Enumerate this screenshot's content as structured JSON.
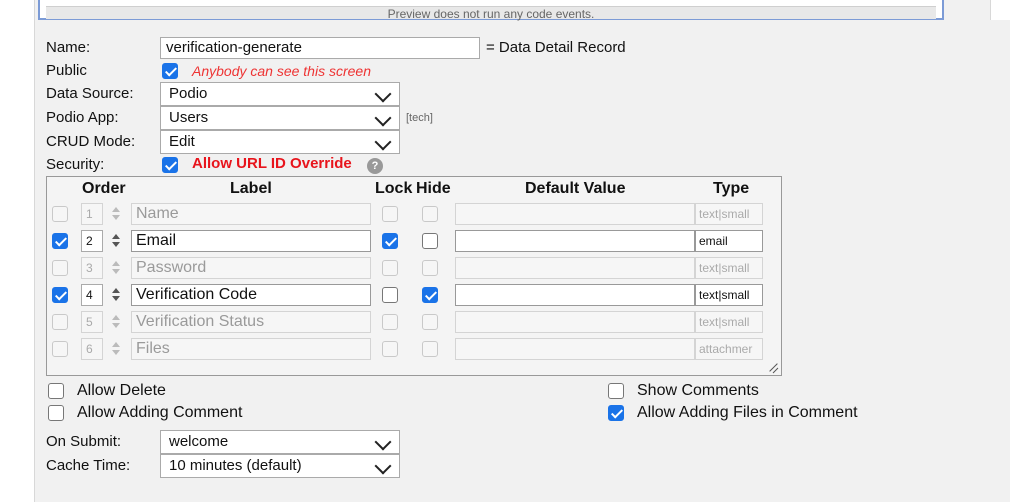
{
  "preview": {
    "note": "Preview does not run any code events."
  },
  "form": {
    "name": {
      "label": "Name:",
      "value": "verification-generate",
      "suffix": "= Data Detail Record"
    },
    "public": {
      "label": "Public",
      "checked": true,
      "hint": "Anybody can see this screen"
    },
    "data_source": {
      "label": "Data Source:",
      "value": "Podio"
    },
    "podio_app": {
      "label": "Podio App:",
      "value": "Users",
      "tag": "[tech]"
    },
    "crud_mode": {
      "label": "CRUD Mode:",
      "value": "Edit"
    },
    "security": {
      "label": "Security:",
      "checked": true,
      "option": "Allow URL ID Override",
      "help": "?"
    }
  },
  "fields_table": {
    "headers": {
      "order": "Order",
      "label": "Label",
      "lock": "Lock",
      "hide": "Hide",
      "default": "Default Value",
      "type": "Type"
    },
    "rows": [
      {
        "enabled": false,
        "order": "1",
        "label": "Name",
        "lock": false,
        "hide": false,
        "default": "",
        "type": "text|small"
      },
      {
        "enabled": true,
        "order": "2",
        "label": "Email",
        "lock": true,
        "hide": false,
        "default": "",
        "type": "email"
      },
      {
        "enabled": false,
        "order": "3",
        "label": "Password",
        "lock": false,
        "hide": false,
        "default": "",
        "type": "text|small"
      },
      {
        "enabled": true,
        "order": "4",
        "label": "Verification Code",
        "lock": false,
        "hide": true,
        "default": "",
        "type": "text|small"
      },
      {
        "enabled": false,
        "order": "5",
        "label": "Verification Status",
        "lock": false,
        "hide": false,
        "default": "",
        "type": "text|small"
      },
      {
        "enabled": false,
        "order": "6",
        "label": "Files",
        "lock": false,
        "hide": false,
        "default": "",
        "type": "attachmer"
      }
    ]
  },
  "options": {
    "allow_delete": {
      "label": "Allow Delete",
      "checked": false
    },
    "allow_adding_comment": {
      "label": "Allow Adding Comment",
      "checked": false
    },
    "show_comments": {
      "label": "Show Comments",
      "checked": false
    },
    "allow_adding_files": {
      "label": "Allow Adding Files in Comment",
      "checked": true
    }
  },
  "on_submit": {
    "label": "On Submit:",
    "value": "welcome"
  },
  "cache_time": {
    "label": "Cache Time:",
    "value": "10 minutes (default)"
  },
  "colors": {
    "accent": "#1a73e8",
    "warning": "#e8141c",
    "frame": "#7c9bd6"
  }
}
